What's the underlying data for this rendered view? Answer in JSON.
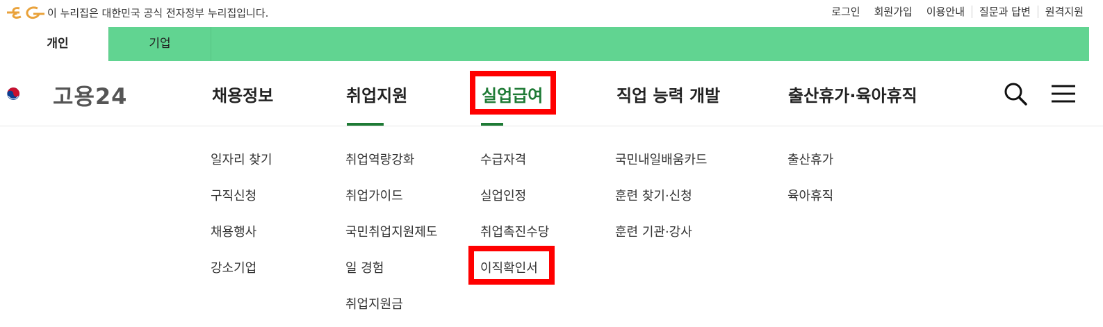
{
  "notice_bar": {
    "notice": "이 누리집은 대한민국 공식 전자정부 누리집입니다.",
    "links": [
      "로그인",
      "회원가입",
      "이용안내",
      "질문과 답변",
      "원격지원"
    ]
  },
  "tabs": [
    {
      "label": "개인",
      "active": true
    },
    {
      "label": "기업",
      "active": false
    }
  ],
  "brand": {
    "name": "고용24"
  },
  "gnb": [
    {
      "label": "채용정보",
      "sub": [
        "일자리 찾기",
        "구직신청",
        "채용행사",
        "강소기업"
      ]
    },
    {
      "label": "취업지원",
      "sub": [
        "취업역량강화",
        "취업가이드",
        "국민취업지원제도",
        "일 경험",
        "취업지원금"
      ]
    },
    {
      "label": "실업급여",
      "sub": [
        "수급자격",
        "실업인정",
        "취업촉진수당",
        "이직확인서"
      ]
    },
    {
      "label": "직업 능력 개발",
      "sub": [
        "국민내일배움카드",
        "훈련 찾기·신청",
        "훈련 기관·강사"
      ]
    },
    {
      "label": "출산휴가·육아휴직",
      "sub": [
        "출산휴가",
        "육아휴직"
      ]
    }
  ],
  "icons": {
    "search": "search-icon",
    "menu": "hamburger-menu-icon"
  },
  "colors": {
    "tab_green": "#61d491",
    "accent_green": "#1e7a35",
    "highlight_red": "#ff0000"
  }
}
